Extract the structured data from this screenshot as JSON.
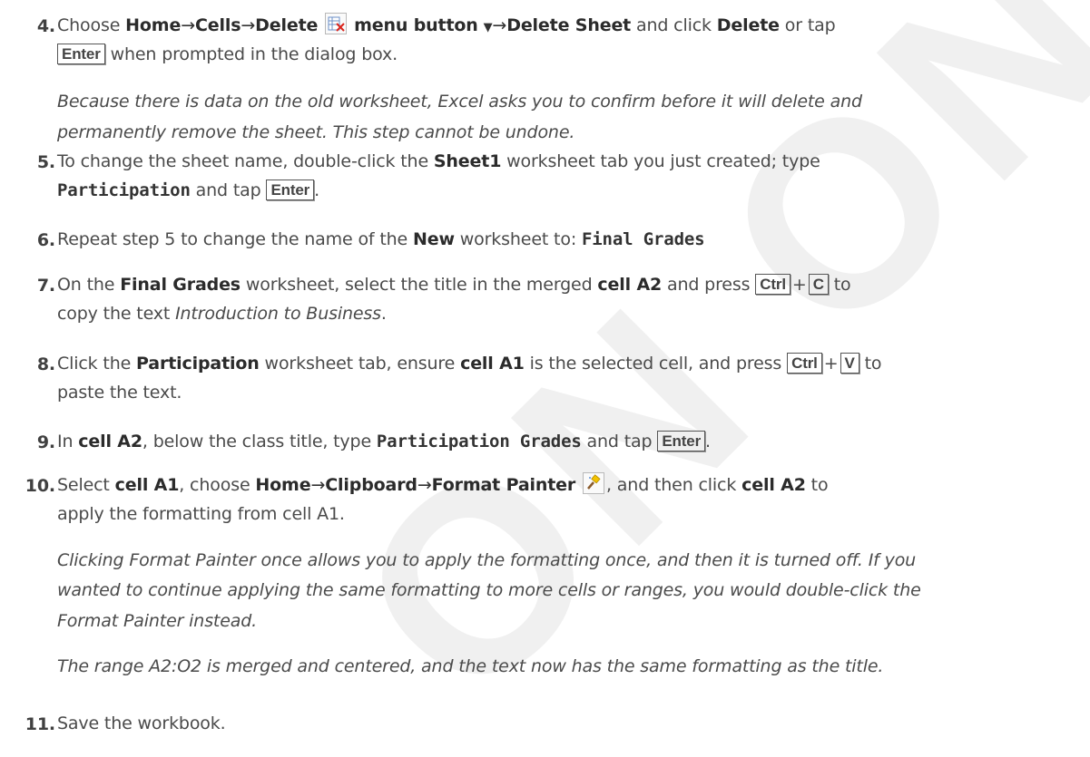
{
  "watermark": "ON ONLY",
  "steps": [
    {
      "num": "4.",
      "line1": {
        "a": "Choose ",
        "b1": "Home",
        "arrow1": "→",
        "b2": "Cells",
        "arrow2": "→",
        "b3": "Delete",
        "b4": "menu button",
        "tri": "▼",
        "arrow3": "→",
        "b5": "Delete Sheet",
        "c": " and click ",
        "b6": "Delete",
        "d": " or tap"
      },
      "line2": {
        "key": "Enter",
        "text": " when prompted in the dialog box."
      },
      "note1": "Because there is data on the old worksheet, Excel asks you to confirm before it will delete and",
      "note2": "permanently remove the sheet. This step cannot be undone."
    },
    {
      "num": "5.",
      "line1": {
        "a": "To change the sheet name, double-click the ",
        "b1": "Sheet1",
        "c": " worksheet tab you just created; type"
      },
      "line2": {
        "mono": "Participation",
        "a": " and tap ",
        "key": "Enter",
        "end": "."
      }
    },
    {
      "num": "6.",
      "line1": {
        "a": "Repeat step 5 to change the name of the ",
        "b1": "New",
        "c": " worksheet to: ",
        "mono": "Final Grades"
      }
    },
    {
      "num": "7.",
      "line1": {
        "a": "On the ",
        "b1": "Final Grades",
        "c": " worksheet, select the title in the merged ",
        "b2": "cell A2",
        "d": " and press ",
        "key1": "Ctrl",
        "plus": "+",
        "key2": "C",
        "e": " to"
      },
      "line2": {
        "a": "copy the text ",
        "i": "Introduction to Business",
        "end": "."
      }
    },
    {
      "num": "8.",
      "line1": {
        "a": "Click the ",
        "b1": "Participation",
        "c": " worksheet tab, ensure ",
        "b2": "cell A1",
        "d": " is the selected cell, and press ",
        "key1": "Ctrl",
        "plus": "+",
        "key2": "V",
        "e": " to"
      },
      "line2": {
        "a": "paste the text."
      }
    },
    {
      "num": "9.",
      "line1": {
        "a": "In ",
        "b1": "cell A2",
        "c": ", below the class title, type ",
        "mono": "Participation Grades",
        "d": " and tap ",
        "key": "Enter",
        "end": "."
      }
    },
    {
      "num": "10.",
      "line1": {
        "a": "Select ",
        "b1": "cell A1",
        "c": ", choose ",
        "b2": "Home",
        "arrow1": "→",
        "b3": "Clipboard",
        "arrow2": "→",
        "b4": "Format Painter",
        "d": ", and then click ",
        "b5": "cell A2",
        "e": " to"
      },
      "line2": {
        "a": "apply the formatting from cell A1."
      },
      "note1": "Clicking Format Painter once allows you to apply the formatting once, and then it is turned off. If you",
      "note2": "wanted to continue applying the same formatting to more cells or ranges, you would double-click the",
      "note3": "Format Painter instead.",
      "note4": "The range A2:O2 is merged and centered, and the text now has the same formatting as the title."
    },
    {
      "num": "11.",
      "line1": {
        "a": "Save the workbook."
      }
    }
  ]
}
